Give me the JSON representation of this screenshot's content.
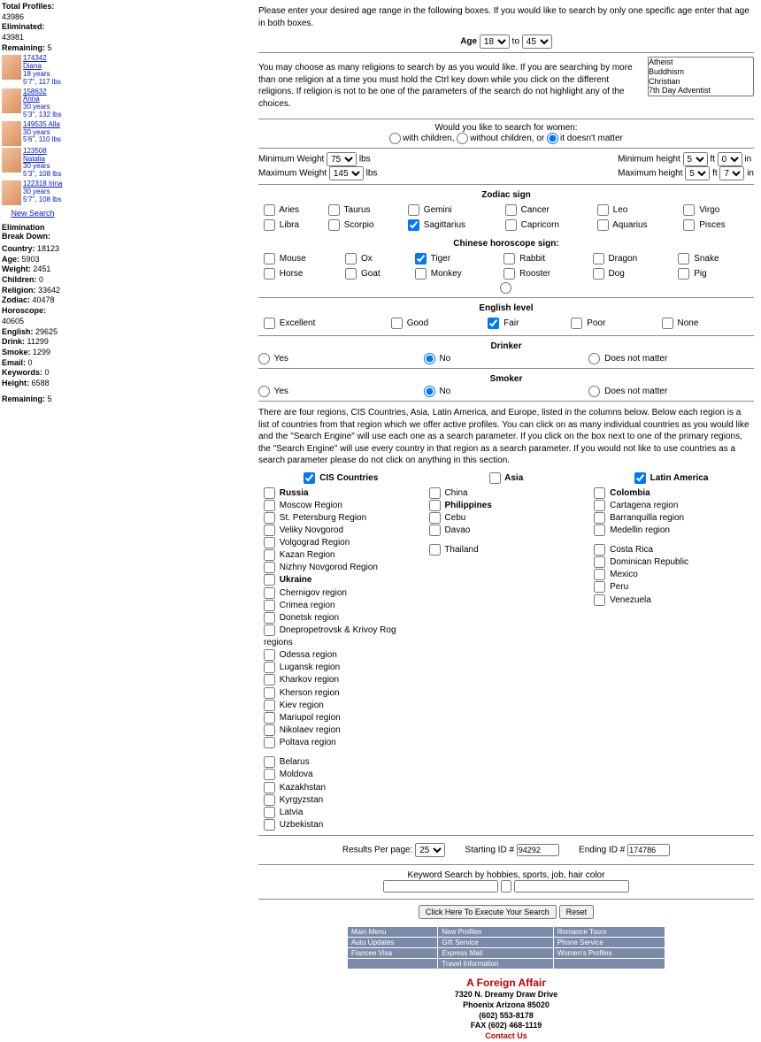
{
  "sidebar": {
    "stats": {
      "total_label": "Total Profiles:",
      "total": "43986",
      "eliminated_label": "Eliminated:",
      "eliminated": "43981",
      "remaining_label": "Remaining:",
      "remaining": "5"
    },
    "profiles": [
      {
        "id": "174342",
        "name": "Diana",
        "age": "18 years",
        "hw": "5'7\", 117 lbs"
      },
      {
        "id": "158632",
        "name": "Anna",
        "age": "30 years",
        "hw": "5'3\", 132 lbs"
      },
      {
        "id": "149535",
        "name": "Alla",
        "age": "30 years",
        "hw": "5'6\", 110 lbs"
      },
      {
        "id": "123508",
        "name": "Natalia",
        "age": "30 years",
        "hw": "5'3\", 108 lbs"
      },
      {
        "id": "122318",
        "name": "Irina",
        "age": "30 years",
        "hw": "5'7\", 108 lbs"
      }
    ],
    "new_search": "New Search",
    "breakdown_title": "Elimination Break Down:",
    "breakdown": [
      {
        "k": "Country:",
        "v": "18123"
      },
      {
        "k": "Age:",
        "v": "5903"
      },
      {
        "k": "Weight:",
        "v": "2451"
      },
      {
        "k": "Children:",
        "v": "0"
      },
      {
        "k": "Religion:",
        "v": "33642"
      },
      {
        "k": "Zodiac:",
        "v": "40478"
      },
      {
        "k": "Horoscope:",
        "v": "40605"
      },
      {
        "k": "English:",
        "v": "29625"
      },
      {
        "k": "Drink:",
        "v": "11299"
      },
      {
        "k": "Smoke:",
        "v": "1299"
      },
      {
        "k": "Email:",
        "v": "0"
      },
      {
        "k": "Keywords:",
        "v": "0"
      },
      {
        "k": "Height:",
        "v": "6588"
      }
    ],
    "remaining2_k": "Remaining:",
    "remaining2_v": "5"
  },
  "age_text": "Please enter your desired age range in the following boxes. If you would like to search by only one specific age enter that age in both boxes.",
  "age_label": "Age",
  "age_from": "18",
  "age_to_label": "to",
  "age_to": "45",
  "religion_text": "You may choose as many religions to search by as you would like. If you are searching by more than one religion at a time you must hold the Ctrl key down while you click on the different religions. If religion is not to be one of the parameters of the search do not highlight any of the choices.",
  "religions": [
    "Atheist",
    "Buddhism",
    "Christian",
    "7th Day Adventist"
  ],
  "children_q": "Would you like to search for women:",
  "children_opts": {
    "with": "with children,",
    "without": "without children, or",
    "doesnt": "it doesn't matter"
  },
  "minmax": {
    "min_w_l": "Minimum Weight",
    "min_w_v": "75",
    "max_w_l": "Maximum Weight",
    "max_w_v": "145",
    "lbs": "lbs",
    "min_h_l": "Minimum height",
    "min_h_f": "5",
    "min_h_i": "0",
    "max_h_l": "Maximum height",
    "max_h_f": "5",
    "max_h_i": "7",
    "in": "in",
    "ft": "ft"
  },
  "zodiac_title": "Zodiac sign",
  "zodiac": [
    "Aries",
    "Taurus",
    "Gemini",
    "Cancer",
    "Leo",
    "Virgo",
    "Libra",
    "Scorpio",
    "Sagittarius",
    "Capricorn",
    "Aquarius",
    "Pisces"
  ],
  "zodiac_checked": "Sagittarius",
  "horo_title": "Chinese horoscope sign:",
  "horo": [
    "Mouse",
    "Ox",
    "Tiger",
    "Rabbit",
    "Dragon",
    "Snake",
    "Horse",
    "Goat",
    "Monkey",
    "Rooster",
    "Dog",
    "Pig"
  ],
  "horo_checked": "Tiger",
  "english_title": "English level",
  "english_opts": [
    "Excellent",
    "Good",
    "Fair",
    "Poor",
    "None"
  ],
  "english_checked": "Fair",
  "drinker_title": "Drinker",
  "yesno_opts": {
    "yes": "Yes",
    "no": "No",
    "dnm": "Does not matter"
  },
  "smoker_title": "Smoker",
  "regions_text": "There are four regions, CIS Countries, Asia, Latin America, and Europe, listed in the columns below. Below each region is a list of countries from that region which we offer active profiles. You can click on as many individual countries as you would like and the \"Search Engine\" will use each one as a search parameter. If you click on the box next to one of the primary regions, the \"Search Engine\" will use every country in that region as a search parameter. If you would not like to use countries as a search parameter please do not click on anything in this section.",
  "regions": {
    "cis": {
      "title": "CIS Countries",
      "groups": [
        {
          "head": "Russia",
          "items": [
            "Moscow Region",
            "St. Petersburg Region",
            "Veliky Novgorod",
            "Volgograd Region",
            "Kazan Region",
            "Nizhny Novgorod Region"
          ]
        },
        {
          "head": "Ukraine",
          "items": [
            "Chernigov region",
            "Crimea region",
            "Donetsk region",
            "Dnepropetrovsk & Krivoy Rog regions",
            "Odessa region",
            "Lugansk region",
            "Kharkov region",
            "Kherson region",
            "Kiev region",
            "Mariupol region",
            "Nikolaev region",
            "Poltava region"
          ]
        },
        {
          "head": null,
          "items": [
            "Belarus",
            "Moldova",
            "Kazakhstan",
            "Kyrgyzstan",
            "Latvia",
            "Uzbekistan"
          ]
        }
      ]
    },
    "asia": {
      "title": "Asia",
      "groups": [
        {
          "head": null,
          "items": [
            "China"
          ]
        },
        {
          "head": "Philippines",
          "items": [
            "Cebu",
            "Davao"
          ]
        },
        {
          "head": null,
          "items": [
            "Thailand"
          ]
        }
      ]
    },
    "latin": {
      "title": "Latin America",
      "groups": [
        {
          "head": "Colombia",
          "items": [
            "Cartagena region",
            "Barranquilla region",
            "Medellin region"
          ]
        },
        {
          "head": null,
          "items": [
            "Costa Rica",
            "Dominican Republic",
            "Mexico",
            "Peru",
            "Venezuela"
          ]
        }
      ]
    }
  },
  "regions_checked": [
    "CIS Countries",
    "Latin America"
  ],
  "results": {
    "rpp_l": "Results Per page:",
    "rpp_v": "25",
    "start_l": "Starting ID #",
    "start_v": "94292",
    "end_l": "Ending ID #",
    "end_v": "174786"
  },
  "keyword_l": "Keyword Search by hobbies, sports, job, hair color",
  "buttons": {
    "exec": "Click Here To Execute Your Search",
    "reset": "Reset"
  },
  "nav": [
    [
      "Main Menu",
      "New Profiles",
      "Romance Tours"
    ],
    [
      "Auto Updates",
      "Gift Service",
      "Phone Service"
    ],
    [
      "Fiancee Visa",
      "Express Mail",
      "Women's Profiles"
    ],
    [
      "",
      "Travel Information",
      ""
    ]
  ],
  "company": {
    "name": "A Foreign Affair",
    "addr1": "7320 N. Dreamy Draw Drive",
    "addr2": "Phoenix Arizona 85020",
    "ph1": "(602) 553-8178",
    "ph2": "FAX (602) 468-1119",
    "contact": "Contact Us"
  }
}
